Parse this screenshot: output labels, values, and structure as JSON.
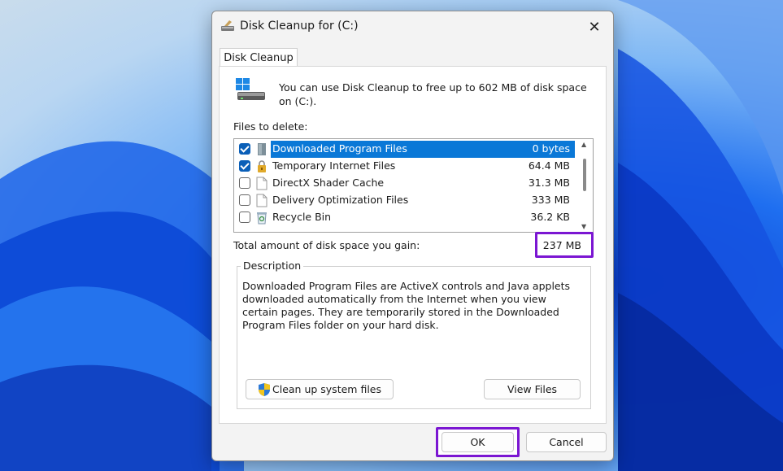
{
  "window": {
    "title": "Disk Cleanup for  (C:)",
    "close_glyph": "✕"
  },
  "tab": {
    "label": "Disk Cleanup"
  },
  "intro": {
    "text": "You can use Disk Cleanup to free up to 602 MB of disk space on (C:)."
  },
  "files_label": "Files to delete:",
  "files": [
    {
      "name": "Downloaded Program Files",
      "size": "0 bytes",
      "checked": true,
      "selected": true,
      "icon": "folder-icon"
    },
    {
      "name": "Temporary Internet Files",
      "size": "64.4 MB",
      "checked": true,
      "selected": false,
      "icon": "lock-icon"
    },
    {
      "name": "DirectX Shader Cache",
      "size": "31.3 MB",
      "checked": false,
      "selected": false,
      "icon": "file-icon"
    },
    {
      "name": "Delivery Optimization Files",
      "size": "333 MB",
      "checked": false,
      "selected": false,
      "icon": "file-icon"
    },
    {
      "name": "Recycle Bin",
      "size": "36.2 KB",
      "checked": false,
      "selected": false,
      "icon": "recycle-bin-icon"
    }
  ],
  "total": {
    "label": "Total amount of disk space you gain:",
    "value": "237 MB"
  },
  "description": {
    "legend": "Description",
    "text": "Downloaded Program Files are ActiveX controls and Java applets downloaded automatically from the Internet when you view certain pages. They are temporarily stored in the Downloaded Program Files folder on your hard disk."
  },
  "buttons": {
    "cleanup_system": "Clean up system files",
    "view_files": "View Files",
    "ok": "OK",
    "cancel": "Cancel"
  },
  "colors": {
    "selection": "#0a78d7",
    "highlight": "#7b16d2",
    "checkbox": "#0a5fb8"
  }
}
